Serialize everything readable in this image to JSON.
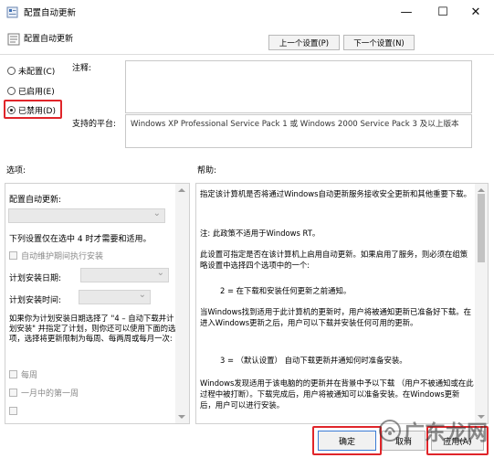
{
  "window": {
    "title": "配置自动更新",
    "minimize_glyph": "—",
    "maximize_glyph": "☐",
    "close_glyph": "✕"
  },
  "header": {
    "title": "配置自动更新",
    "prev_button": "上一个设置(P)",
    "next_button": "下一个设置(N)"
  },
  "state": {
    "options": [
      {
        "label": "未配置(C)",
        "selected": false
      },
      {
        "label": "已启用(E)",
        "selected": false
      },
      {
        "label": "已禁用(D)",
        "selected": true
      }
    ]
  },
  "comment": {
    "label": "注释:",
    "value": ""
  },
  "platform": {
    "label": "支持的平台:",
    "value": "Windows XP Professional Service Pack 1 或 Windows 2000 Service Pack 3 及以上版本"
  },
  "options_panel": {
    "label": "选项:",
    "configure_label": "配置自动更新:",
    "line1": "下列设置仅在选中 4 时才需要和适用。",
    "maintenance_checkbox": "自动维护期间执行安装",
    "schedule_day_label": "计划安装日期:",
    "schedule_time_label": "计划安装时间:",
    "note": "如果你为计划安装日期选择了 \"4 – 自动下载并计划安装\" 并指定了计划，则你还可以使用下面的选项，选择将更新限制为每周、每两周或每月一次:",
    "checkboxes": [
      "每周",
      "一月中的第一周"
    ]
  },
  "help_panel": {
    "label": "帮助:",
    "paragraphs": [
      "指定该计算机是否将通过Windows自动更新服务接收安全更新和其他重要下载。",
      "注: 此政策不适用于Windows RT。",
      "此设置可指定是否在该计算机上启用自动更新。如果启用了服务，则必须在组策略设置中选择四个选项中的一个:",
      "2 = 在下载和安装任何更新之前通知。",
      "当Windows找到适用于此计算机的更新时，用户将被通知更新已准备好下载。在进入Windows更新之后，用户可以下载并安装任何可用的更新。",
      "3 = （默认设置） 自动下载更新并通知何时准备安装。",
      "Windows发现适用于该电脑的的更新并在背景中予以下载 （用户不被通知或在此过程中被打断）。下载完成后，用户将被通知可以准备安装。在Windows更新后，用户可以进行安装。"
    ]
  },
  "buttons": {
    "ok": "确定",
    "cancel": "取消",
    "apply": "应用(A)"
  },
  "watermark": {
    "text": "广东龙网"
  },
  "colors": {
    "highlight_red": "#e0252a",
    "ok_border": "#3a7bd5"
  }
}
